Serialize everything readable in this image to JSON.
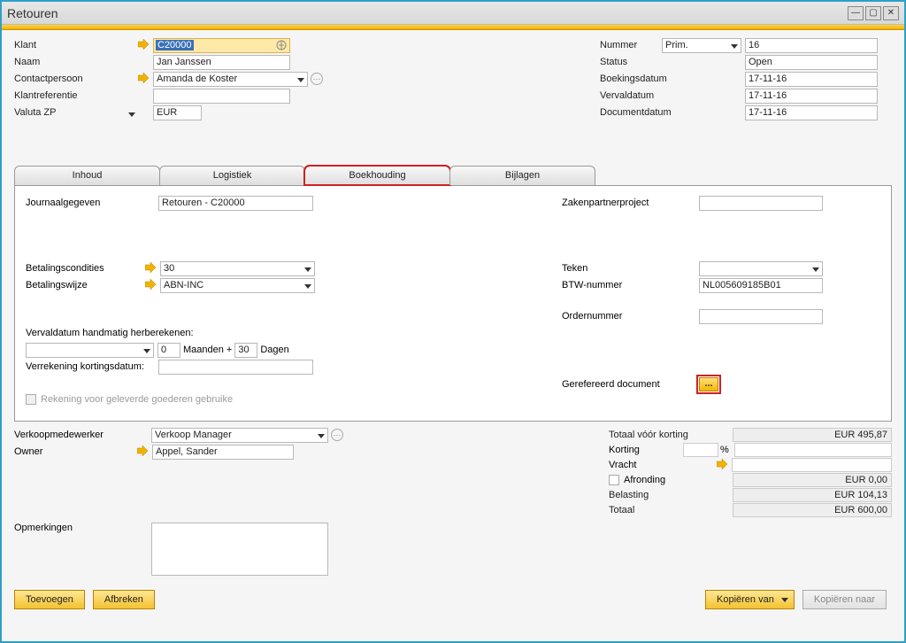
{
  "window": {
    "title": "Retouren"
  },
  "header_left": {
    "klant_label": "Klant",
    "klant_value": "C20000",
    "naam_label": "Naam",
    "naam_value": "Jan Janssen",
    "contact_label": "Contactpersoon",
    "contact_value": "Amanda de Koster",
    "klantref_label": "Klantreferentie",
    "klantref_value": "",
    "valuta_label": "Valuta ZP",
    "valuta_value": "EUR"
  },
  "header_right": {
    "nummer_label": "Nummer",
    "nummer_sel": "Prim.",
    "nummer_value": "16",
    "status_label": "Status",
    "status_value": "Open",
    "boekdatum_label": "Boekingsdatum",
    "boekdatum_value": "17-11-16",
    "verval_label": "Vervaldatum",
    "verval_value": "17-11-16",
    "docdatum_label": "Documentdatum",
    "docdatum_value": "17-11-16"
  },
  "tabs": {
    "inhoud": "Inhoud",
    "logistiek": "Logistiek",
    "boekhouding": "Boekhouding",
    "bijlagen": "Bijlagen"
  },
  "boekh_left": {
    "journaal_label": "Journaalgegeven",
    "journaal_value": "Retouren - C20000",
    "betcond_label": "Betalingscondities",
    "betcond_value": "30",
    "betwijze_label": "Betalingswijze",
    "betwijze_value": "ABN-INC",
    "recalc_label": "Vervaldatum handmatig herberekenen:",
    "maanden_value": "0",
    "maanden_unit": "Maanden +",
    "dagen_value": "30",
    "dagen_unit": "Dagen",
    "verrek_label": "Verrekening kortingsdatum:",
    "rekchk_label": "Rekening voor geleverde goederen gebruike"
  },
  "boekh_right": {
    "proj_label": "Zakenpartnerproject",
    "proj_value": "",
    "teken_label": "Teken",
    "teken_value": "",
    "btw_label": "BTW-nummer",
    "btw_value": "NL005609185B01",
    "order_label": "Ordernummer",
    "order_value": "",
    "refdoc_label": "Gerefereerd document",
    "refdoc_btn": "..."
  },
  "below_left": {
    "verkoop_label": "Verkoopmedewerker",
    "verkoop_value": "Verkoop Manager",
    "owner_label": "Owner",
    "owner_value": "Appel, Sander",
    "opm_label": "Opmerkingen"
  },
  "totals": {
    "subtotal_label": "Totaal vóór korting",
    "subtotal_value": "EUR 495,87",
    "korting_label": "Korting",
    "korting_pct": "",
    "korting_unit": "%",
    "korting_value": "",
    "vracht_label": "Vracht",
    "vracht_value": "",
    "afr_label": "Afronding",
    "afr_value": "EUR 0,00",
    "bel_label": "Belasting",
    "bel_value": "EUR 104,13",
    "tot_label": "Totaal",
    "tot_value": "EUR 600,00"
  },
  "footer": {
    "toevoegen": "Toevoegen",
    "afbreken": "Afbreken",
    "kopvan": "Kopiëren van",
    "kopnaar": "Kopiëren naar"
  }
}
